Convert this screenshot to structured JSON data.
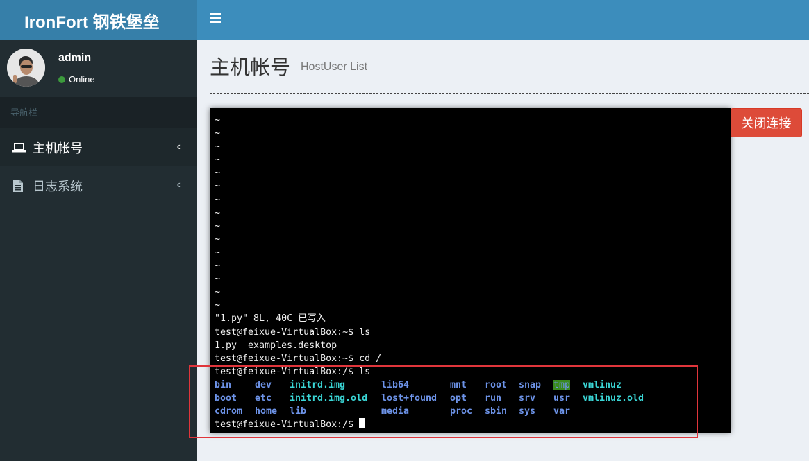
{
  "app": {
    "logo": "IronFort  钢铁堡垒"
  },
  "user": {
    "name": "admin",
    "status": "Online"
  },
  "sidebar": {
    "header": "导航栏",
    "items": [
      {
        "label": "主机帐号",
        "icon": "laptop-icon",
        "active": true
      },
      {
        "label": "日志系统",
        "icon": "file-text-icon",
        "active": false
      }
    ]
  },
  "page": {
    "title": "主机帐号",
    "subtitle": "HostUser List"
  },
  "actions": {
    "close_label": "关闭连接"
  },
  "terminal": {
    "tilde_lines": [
      "~",
      "~",
      "~",
      "~",
      "~",
      "~",
      "~",
      "~",
      "~",
      "~",
      "~",
      "~",
      "~",
      "~",
      "~"
    ],
    "lines": [
      "\"1.py\" 8L, 40C 已写入",
      "test@feixue-VirtualBox:~$ ls",
      "1.py  examples.desktop",
      "test@feixue-VirtualBox:~$ cd /",
      "test@feixue-VirtualBox:/$ ls"
    ],
    "ls_rows": [
      [
        "bin",
        "dev",
        "initrd.img",
        "lib64",
        "mnt",
        "root",
        "snap",
        "tmp",
        "vmlinuz"
      ],
      [
        "boot",
        "etc",
        "initrd.img.old",
        "lost+found",
        "opt",
        "run",
        "srv",
        "usr",
        "vmlinuz.old"
      ],
      [
        "cdrom",
        "home",
        "lib",
        "",
        "media",
        "proc",
        "sbin",
        "sys",
        "var"
      ]
    ],
    "prompt": "test@feixue-VirtualBox:/$ "
  },
  "colors": {
    "header": "#3c8dbc",
    "logo_bg": "#367fa9",
    "sidebar": "#222d32",
    "close_button": "#dd4b39",
    "highlight_box": "#e0353b"
  }
}
